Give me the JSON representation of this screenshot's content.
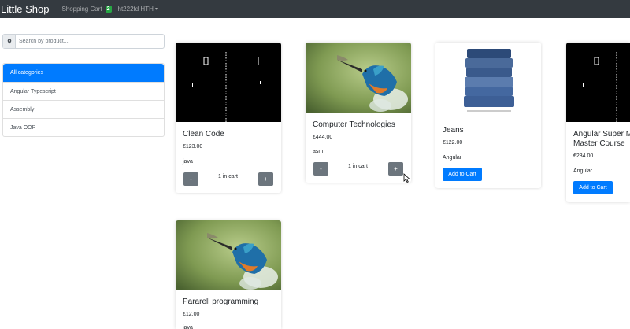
{
  "navbar": {
    "brand": "Little Shop",
    "cart_label": "Shopping Cart",
    "cart_count": "2",
    "user": "ht222fd HTH"
  },
  "search": {
    "placeholder": "Search by product..."
  },
  "categories": [
    "All categories",
    "Angular Typescript",
    "Assembly",
    "Java OOP"
  ],
  "products": [
    {
      "title": "Clean Code",
      "price": "€123.00",
      "category": "java",
      "in_cart": "1 in cart"
    },
    {
      "title": "Computer Technologies",
      "price": "€444.00",
      "category": "asm",
      "in_cart": "1 in cart"
    },
    {
      "title": "Jeans",
      "price": "€122.00",
      "category": "Angular",
      "add_label": "Add to Cart"
    },
    {
      "title": "Angular Super Mega Master Course",
      "price": "€234.00",
      "category": "Angular",
      "add_label": "Add to Cart"
    },
    {
      "title": "Pararell programming",
      "price": "€12.00",
      "category": "java"
    }
  ],
  "buttons": {
    "minus": "-",
    "plus": "+"
  },
  "colors": {
    "navbar": "#343a40",
    "primary": "#007bff",
    "secondary": "#6c757d",
    "badge": "#28a745"
  }
}
